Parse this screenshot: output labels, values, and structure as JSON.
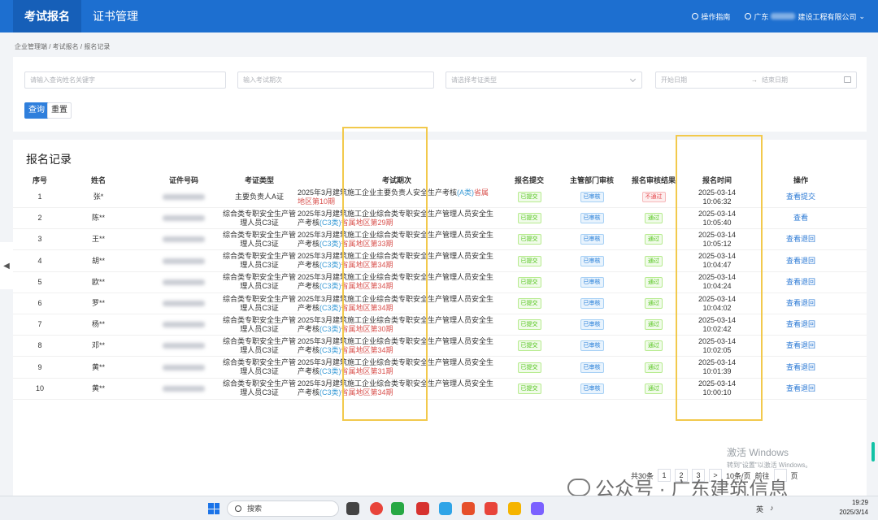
{
  "nav": {
    "tabs": [
      "考试报名",
      "证书管理"
    ],
    "help": "操作指南",
    "company_prefix": "广东",
    "company_suffix": "建设工程有限公司"
  },
  "breadcrumb": "企业管理端 / 考试报名 / 报名记录",
  "filters": {
    "keyword_placeholder": "请输入查询姓名关键字",
    "period_placeholder": "输入考试期次",
    "type_placeholder": "请选择考证类型",
    "start_placeholder": "开始日期",
    "end_placeholder": "结束日期",
    "date_separator": "→",
    "search_label": "查询",
    "reset_label": "重置"
  },
  "records": {
    "title": "报名记录",
    "columns": [
      "序号",
      "姓名",
      "证件号码",
      "考证类型",
      "考试期次",
      "报名提交",
      "主管部门审核",
      "报名审核结果",
      "报名时间",
      "操作"
    ],
    "rows": [
      {
        "no": "1",
        "name": "张*",
        "type": "主要负责人A证",
        "period_main": "2025年3月建筑施工企业主要负责人安全生产考核",
        "period_cls": "(A类)",
        "period_area": "省属地区第10期",
        "submit": "已提交",
        "dept": "已审核",
        "result": "不通过",
        "result_color": "red",
        "date": "2025-03-14",
        "time": "10:06:32",
        "op1": "查看",
        "op2": "提交"
      },
      {
        "no": "2",
        "name": "陈**",
        "type": "综合类专职安全生产管理人员C3证",
        "period_main": "2025年3月建筑施工企业综合类专职安全生产管理人员安全生产考核",
        "period_cls": "(C3类)",
        "period_area": "省属地区第29期",
        "submit": "已提交",
        "dept": "已审核",
        "result": "通过",
        "result_color": "green",
        "date": "2025-03-14",
        "time": "10:05:40",
        "op1": "查看",
        "op2": ""
      },
      {
        "no": "3",
        "name": "王**",
        "type": "综合类专职安全生产管理人员C3证",
        "period_main": "2025年3月建筑施工企业综合类专职安全生产管理人员安全生产考核",
        "period_cls": "(C3类)",
        "period_area": "省属地区第33期",
        "submit": "已提交",
        "dept": "已审核",
        "result": "通过",
        "result_color": "green",
        "date": "2025-03-14",
        "time": "10:05:12",
        "op1": "查看",
        "op2": "退回"
      },
      {
        "no": "4",
        "name": "胡**",
        "type": "综合类专职安全生产管理人员C3证",
        "period_main": "2025年3月建筑施工企业综合类专职安全生产管理人员安全生产考核",
        "period_cls": "(C3类)",
        "period_area": "省属地区第34期",
        "submit": "已提交",
        "dept": "已审核",
        "result": "通过",
        "result_color": "green",
        "date": "2025-03-14",
        "time": "10:04:47",
        "op1": "查看",
        "op2": "退回"
      },
      {
        "no": "5",
        "name": "欧**",
        "type": "综合类专职安全生产管理人员C3证",
        "period_main": "2025年3月建筑施工企业综合类专职安全生产管理人员安全生产考核",
        "period_cls": "(C3类)",
        "period_area": "省属地区第34期",
        "submit": "已提交",
        "dept": "已审核",
        "result": "通过",
        "result_color": "green",
        "date": "2025-03-14",
        "time": "10:04:24",
        "op1": "查看",
        "op2": "退回"
      },
      {
        "no": "6",
        "name": "罗**",
        "type": "综合类专职安全生产管理人员C3证",
        "period_main": "2025年3月建筑施工企业综合类专职安全生产管理人员安全生产考核",
        "period_cls": "(C3类)",
        "period_area": "省属地区第34期",
        "submit": "已提交",
        "dept": "已审核",
        "result": "通过",
        "result_color": "green",
        "date": "2025-03-14",
        "time": "10:04:02",
        "op1": "查看",
        "op2": "退回"
      },
      {
        "no": "7",
        "name": "杨**",
        "type": "综合类专职安全生产管理人员C3证",
        "period_main": "2025年3月建筑施工企业综合类专职安全生产管理人员安全生产考核",
        "period_cls": "(C3类)",
        "period_area": "省属地区第30期",
        "submit": "已提交",
        "dept": "已审核",
        "result": "通过",
        "result_color": "green",
        "date": "2025-03-14",
        "time": "10:02:42",
        "op1": "查看",
        "op2": "退回"
      },
      {
        "no": "8",
        "name": "邓**",
        "type": "综合类专职安全生产管理人员C3证",
        "period_main": "2025年3月建筑施工企业综合类专职安全生产管理人员安全生产考核",
        "period_cls": "(C3类)",
        "period_area": "省属地区第34期",
        "submit": "已提交",
        "dept": "已审核",
        "result": "通过",
        "result_color": "green",
        "date": "2025-03-14",
        "time": "10:02:05",
        "op1": "查看",
        "op2": "退回"
      },
      {
        "no": "9",
        "name": "黄**",
        "type": "综合类专职安全生产管理人员C3证",
        "period_main": "2025年3月建筑施工企业综合类专职安全生产管理人员安全生产考核",
        "period_cls": "(C3类)",
        "period_area": "省属地区第31期",
        "submit": "已提交",
        "dept": "已审核",
        "result": "通过",
        "result_color": "green",
        "date": "2025-03-14",
        "time": "10:01:39",
        "op1": "查看",
        "op2": "退回"
      },
      {
        "no": "10",
        "name": "黄**",
        "type": "综合类专职安全生产管理人员C3证",
        "period_main": "2025年3月建筑施工企业综合类专职安全生产管理人员安全生产考核",
        "period_cls": "(C3类)",
        "period_area": "省属地区第34期",
        "submit": "已提交",
        "dept": "已审核",
        "result": "通过",
        "result_color": "green",
        "date": "2025-03-14",
        "time": "10:00:10",
        "op1": "查看",
        "op2": "退回"
      }
    ]
  },
  "pager": {
    "total": "共30条",
    "pages": [
      "1",
      "2",
      "3"
    ],
    "next": ">",
    "size": "10条/页",
    "goto": "前往",
    "page_suffix": "页"
  },
  "activation": {
    "title": "激活 Windows",
    "subtitle": "转到\"设置\"以激活 Windows。"
  },
  "watermark": "公众号 · 广东建筑信息",
  "taskbar": {
    "search": "搜索",
    "lang": "英",
    "time": "19:29",
    "date": "2025/3/14"
  },
  "colors": {
    "primary": "#1d6fd0",
    "highlight": "#f2c94c",
    "pass": "#52c41a",
    "fail": "#e5484d"
  }
}
